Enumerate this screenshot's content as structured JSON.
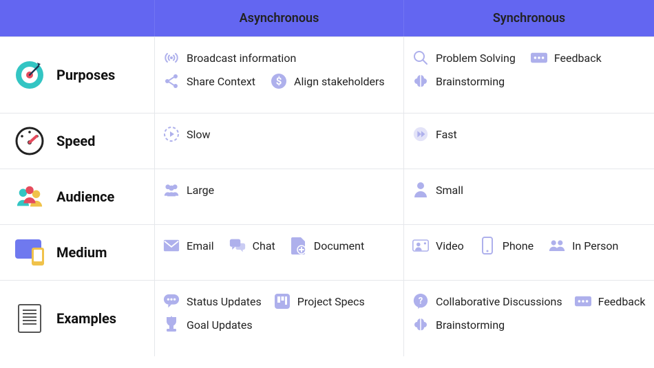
{
  "headers": {
    "blank": "",
    "async": "Asynchronous",
    "sync": "Synchronous"
  },
  "rows": {
    "purposes": {
      "label": "Purposes",
      "async": [
        {
          "label": "Broadcast information",
          "icon": "broadcast-icon"
        },
        {
          "label": "Share Context",
          "icon": "share-icon"
        },
        {
          "label": "Align stakeholders",
          "icon": "dollar-icon"
        }
      ],
      "sync": [
        {
          "label": "Problem Solving",
          "icon": "magnifier-icon"
        },
        {
          "label": "Feedback",
          "icon": "dots-box-icon"
        },
        {
          "label": "Brainstorming",
          "icon": "brain-icon"
        }
      ]
    },
    "speed": {
      "label": "Speed",
      "async": [
        {
          "label": "Slow",
          "icon": "play-dashed-icon"
        }
      ],
      "sync": [
        {
          "label": "Fast",
          "icon": "fast-forward-icon"
        }
      ]
    },
    "audience": {
      "label": "Audience",
      "async": [
        {
          "label": "Large",
          "icon": "group-icon"
        }
      ],
      "sync": [
        {
          "label": "Small",
          "icon": "person-icon"
        }
      ]
    },
    "medium": {
      "label": "Medium",
      "async": [
        {
          "label": "Email",
          "icon": "envelope-icon"
        },
        {
          "label": "Chat",
          "icon": "chat-bubbles-icon"
        },
        {
          "label": "Document",
          "icon": "document-add-icon"
        }
      ],
      "sync": [
        {
          "label": "Video",
          "icon": "video-person-icon"
        },
        {
          "label": "Phone",
          "icon": "phone-icon"
        },
        {
          "label": "In Person",
          "icon": "two-people-icon"
        }
      ]
    },
    "examples": {
      "label": "Examples",
      "async": [
        {
          "label": "Status Updates",
          "icon": "chat-dots-icon"
        },
        {
          "label": "Project Specs",
          "icon": "board-icon"
        },
        {
          "label": "Goal Updates",
          "icon": "trophy-icon"
        }
      ],
      "sync": [
        {
          "label": "Collaborative Discussions",
          "icon": "question-bubble-icon"
        },
        {
          "label": "Feedback",
          "icon": "dots-box-icon"
        },
        {
          "label": "Brainstorming",
          "icon": "brain-icon"
        }
      ]
    }
  }
}
